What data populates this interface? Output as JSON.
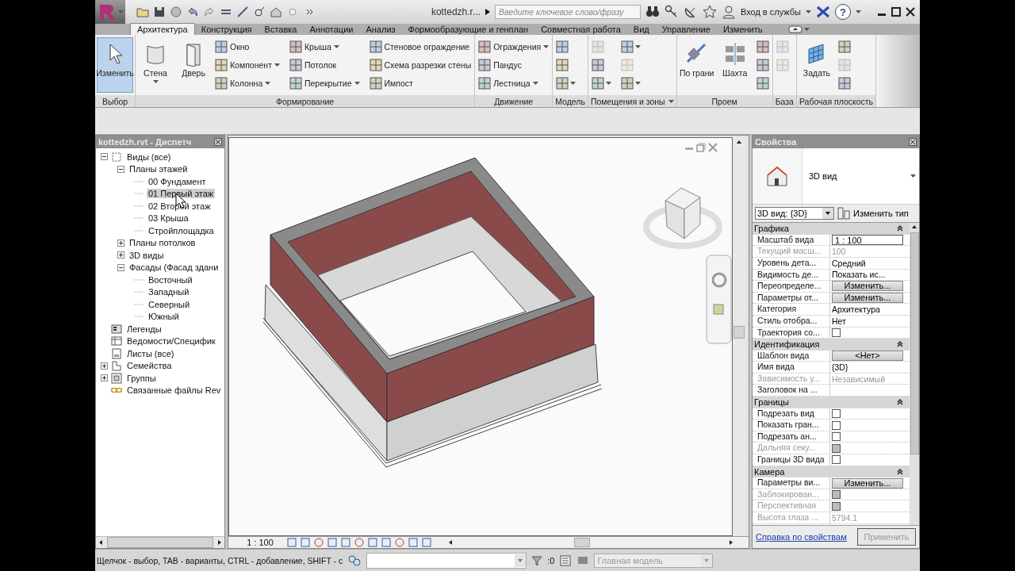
{
  "title_bar": {
    "document": "kottedzh.r...",
    "search": {
      "placeholder": "Введите ключевое слово/фразу"
    },
    "sign_in": "Вход в службы",
    "help": "?"
  },
  "tabs": [
    {
      "label": "Архитектура",
      "selected": true
    },
    {
      "label": "Конструкция",
      "selected": false
    },
    {
      "label": "Вставка",
      "selected": false
    },
    {
      "label": "Аннотации",
      "selected": false
    },
    {
      "label": "Анализ",
      "selected": false
    },
    {
      "label": "Формообразующие и генплан",
      "selected": false
    },
    {
      "label": "Совместная работа",
      "selected": false
    },
    {
      "label": "Вид",
      "selected": false
    },
    {
      "label": "Управление",
      "selected": false
    },
    {
      "label": "Изменить",
      "selected": false
    }
  ],
  "ribbon": {
    "panels": [
      {
        "title": "Выбор",
        "expandable": false,
        "tools": [
          {
            "kind": "large",
            "label": "Изменить",
            "selected": true,
            "dropdown": false,
            "disabled": false
          }
        ]
      },
      {
        "title": "Формирование",
        "expandable": false,
        "tools": [
          {
            "kind": "large",
            "label": "Стена",
            "selected": false,
            "dropdown": true,
            "disabled": false
          },
          {
            "kind": "large",
            "label": "Дверь",
            "selected": false,
            "dropdown": false,
            "disabled": false
          },
          {
            "kind": "small",
            "label": "Окно",
            "selected": false,
            "dropdown": false,
            "disabled": false
          },
          {
            "kind": "small",
            "label": "Компонент",
            "selected": false,
            "dropdown": true,
            "disabled": false
          },
          {
            "kind": "small",
            "label": "Колонна",
            "selected": false,
            "dropdown": true,
            "disabled": false
          },
          {
            "kind": "small",
            "label": "Крыша",
            "selected": false,
            "dropdown": true,
            "disabled": false
          },
          {
            "kind": "small",
            "label": "Потолок",
            "selected": false,
            "dropdown": false,
            "disabled": false
          },
          {
            "kind": "small",
            "label": "Перекрытие",
            "selected": false,
            "dropdown": true,
            "disabled": false
          },
          {
            "kind": "small",
            "label": "Стеновое ограждение",
            "selected": false,
            "dropdown": false,
            "disabled": false
          },
          {
            "kind": "small",
            "label": "Схема разрезки стены",
            "selected": false,
            "dropdown": false,
            "disabled": false
          },
          {
            "kind": "small",
            "label": "Импост",
            "selected": false,
            "dropdown": false,
            "disabled": false
          }
        ]
      },
      {
        "title": "Движение",
        "expandable": false,
        "tools": [
          {
            "kind": "small",
            "label": "Ограждения",
            "selected": false,
            "dropdown": true,
            "disabled": false
          },
          {
            "kind": "small",
            "label": "Пандус",
            "selected": false,
            "dropdown": false,
            "disabled": false
          },
          {
            "kind": "small",
            "label": "Лестница",
            "selected": false,
            "dropdown": true,
            "disabled": false
          }
        ]
      },
      {
        "title": "Модель",
        "expandable": false,
        "tools": [
          {
            "kind": "icon",
            "selected": false,
            "dropdown": false,
            "disabled": false
          },
          {
            "kind": "icon",
            "selected": false,
            "dropdown": false,
            "disabled": false
          },
          {
            "kind": "icon",
            "selected": false,
            "dropdown": true,
            "disabled": false
          }
        ]
      },
      {
        "title": "Помещения и зоны",
        "expandable": true,
        "tools": [
          {
            "kind": "icon",
            "selected": false,
            "dropdown": false,
            "disabled": true
          },
          {
            "kind": "icon",
            "selected": false,
            "dropdown": false,
            "disabled": false
          },
          {
            "kind": "icon",
            "selected": false,
            "dropdown": true,
            "disabled": false
          },
          {
            "kind": "icon",
            "selected": false,
            "dropdown": true,
            "disabled": false
          },
          {
            "kind": "icon",
            "selected": false,
            "dropdown": false,
            "disabled": true
          },
          {
            "kind": "icon",
            "selected": false,
            "dropdown": true,
            "disabled": false
          }
        ]
      },
      {
        "title": "Проем",
        "expandable": false,
        "tools": [
          {
            "kind": "large",
            "label": "По грани",
            "selected": false,
            "dropdown": false,
            "disabled": false
          },
          {
            "kind": "large",
            "label": "Шахта",
            "selected": false,
            "dropdown": false,
            "disabled": false
          },
          {
            "kind": "icon",
            "selected": false,
            "dropdown": false,
            "disabled": false
          },
          {
            "kind": "icon",
            "selected": false,
            "dropdown": false,
            "disabled": false
          },
          {
            "kind": "icon",
            "selected": false,
            "dropdown": false,
            "disabled": false
          }
        ]
      },
      {
        "title": "База",
        "expandable": false,
        "tools": [
          {
            "kind": "icon",
            "selected": false,
            "dropdown": false,
            "disabled": true
          },
          {
            "kind": "icon",
            "selected": false,
            "dropdown": false,
            "disabled": true
          }
        ]
      },
      {
        "title": "Рабочая плоскость",
        "expandable": false,
        "tools": [
          {
            "kind": "large",
            "label": "Задать",
            "selected": false,
            "dropdown": false,
            "disabled": false
          },
          {
            "kind": "icon",
            "selected": false,
            "dropdown": false,
            "disabled": false
          },
          {
            "kind": "icon",
            "selected": false,
            "dropdown": false,
            "disabled": true
          },
          {
            "kind": "icon",
            "selected": false,
            "dropdown": false,
            "disabled": false
          }
        ]
      }
    ]
  },
  "project_browser": {
    "title": "kottedzh.rvt - Диспетч",
    "tree": [
      {
        "label": "Виды (все)",
        "expanded": true,
        "selected": false,
        "children": [
          {
            "label": "Планы этажей",
            "expanded": true,
            "selected": false,
            "children": [
              {
                "label": "00 Фундамент",
                "selected": false
              },
              {
                "label": "01 Первый этаж",
                "selected": true
              },
              {
                "label": "02 Второй этаж",
                "selected": false
              },
              {
                "label": "03 Крыша",
                "selected": false
              },
              {
                "label": "Стройплощадка",
                "selected": false
              }
            ]
          },
          {
            "label": "Планы потолков",
            "expanded": false,
            "selected": false
          },
          {
            "label": "3D виды",
            "expanded": false,
            "selected": false
          },
          {
            "label": "Фасады (Фасад здани",
            "expanded": true,
            "selected": false,
            "children": [
              {
                "label": "Восточный",
                "selected": false
              },
              {
                "label": "Западный",
                "selected": false
              },
              {
                "label": "Северный",
                "selected": false
              },
              {
                "label": "Южный",
                "selected": false
              }
            ]
          }
        ]
      },
      {
        "label": "Легенды",
        "selected": false
      },
      {
        "label": "Ведомости/Специфик",
        "selected": false
      },
      {
        "label": "Листы (все)",
        "selected": false
      },
      {
        "label": "Семейства",
        "expanded": false,
        "selected": false
      },
      {
        "label": "Группы",
        "expanded": false,
        "selected": false
      },
      {
        "label": "Связанные файлы Rev",
        "selected": false
      }
    ]
  },
  "viewport": {
    "scale": "1 : 100"
  },
  "properties": {
    "title": "Свойства",
    "type_name": "3D вид",
    "instance": "3D вид: {3D}",
    "edit_type": "Изменить тип",
    "groups": [
      {
        "title": "Графика",
        "expanded": true,
        "rows": [
          {
            "kind": "input",
            "label": "Масштаб вида",
            "value": "1 : 100",
            "disabled": false
          },
          {
            "kind": "text",
            "label": "Текущий масш...",
            "value": "100",
            "disabled": true
          },
          {
            "kind": "text",
            "label": "Уровень дета...",
            "value": "Средний",
            "disabled": false
          },
          {
            "kind": "text",
            "label": "Видимость де...",
            "value": "Показать ис...",
            "disabled": false
          },
          {
            "kind": "button",
            "label": "Переопределе...",
            "value": "Изменить...",
            "disabled": false
          },
          {
            "kind": "button",
            "label": "Параметры от...",
            "value": "Изменить...",
            "disabled": false
          },
          {
            "kind": "text",
            "label": "Категория",
            "value": "Архитектура",
            "disabled": false
          },
          {
            "kind": "text",
            "label": "Стиль отобра...",
            "value": "Нет",
            "disabled": false
          },
          {
            "kind": "checkbox",
            "label": "Траектория со...",
            "checked": false,
            "disabled": false
          }
        ]
      },
      {
        "title": "Идентификация",
        "expanded": true,
        "rows": [
          {
            "kind": "button",
            "label": "Шаблон вида",
            "value": "<Нет>",
            "disabled": false
          },
          {
            "kind": "text",
            "label": "Имя вида",
            "value": "{3D}",
            "disabled": false
          },
          {
            "kind": "text",
            "label": "Зависимость у...",
            "value": "Независимый",
            "disabled": true
          },
          {
            "kind": "text",
            "label": "Заголовок на ...",
            "disabled": false
          }
        ]
      },
      {
        "title": "Границы",
        "expanded": true,
        "rows": [
          {
            "kind": "checkbox",
            "label": "Подрезать вид",
            "checked": false,
            "disabled": false
          },
          {
            "kind": "checkbox",
            "label": "Показать гран...",
            "checked": false,
            "disabled": false
          },
          {
            "kind": "checkbox",
            "label": "Подрезать ан...",
            "checked": false,
            "disabled": false
          },
          {
            "kind": "checkbox",
            "label": "Дальняя секу...",
            "checked": false,
            "disabled": true
          },
          {
            "kind": "checkbox",
            "label": "Границы 3D вида",
            "checked": false,
            "disabled": false
          }
        ]
      },
      {
        "title": "Камера",
        "expanded": true,
        "rows": [
          {
            "kind": "button",
            "label": "Параметры ви...",
            "value": "Изменить...",
            "disabled": false
          },
          {
            "kind": "checkbox",
            "label": "Заблокирован...",
            "checked": false,
            "disabled": true
          },
          {
            "kind": "checkbox",
            "label": "Перспективная",
            "checked": false,
            "disabled": true
          },
          {
            "kind": "text",
            "label": "Высота глаза ...",
            "value": "5794.1",
            "disabled": true
          }
        ]
      }
    ],
    "help_link": "Справка по свойствам",
    "apply": {
      "label": "Применить",
      "disabled": true
    }
  },
  "status_bar": {
    "hint": "Щелчок - выбор, TAB - варианты, CTRL - добавление, SHIFT - с",
    "filter_count": ":0",
    "workset": "Главная модель"
  }
}
